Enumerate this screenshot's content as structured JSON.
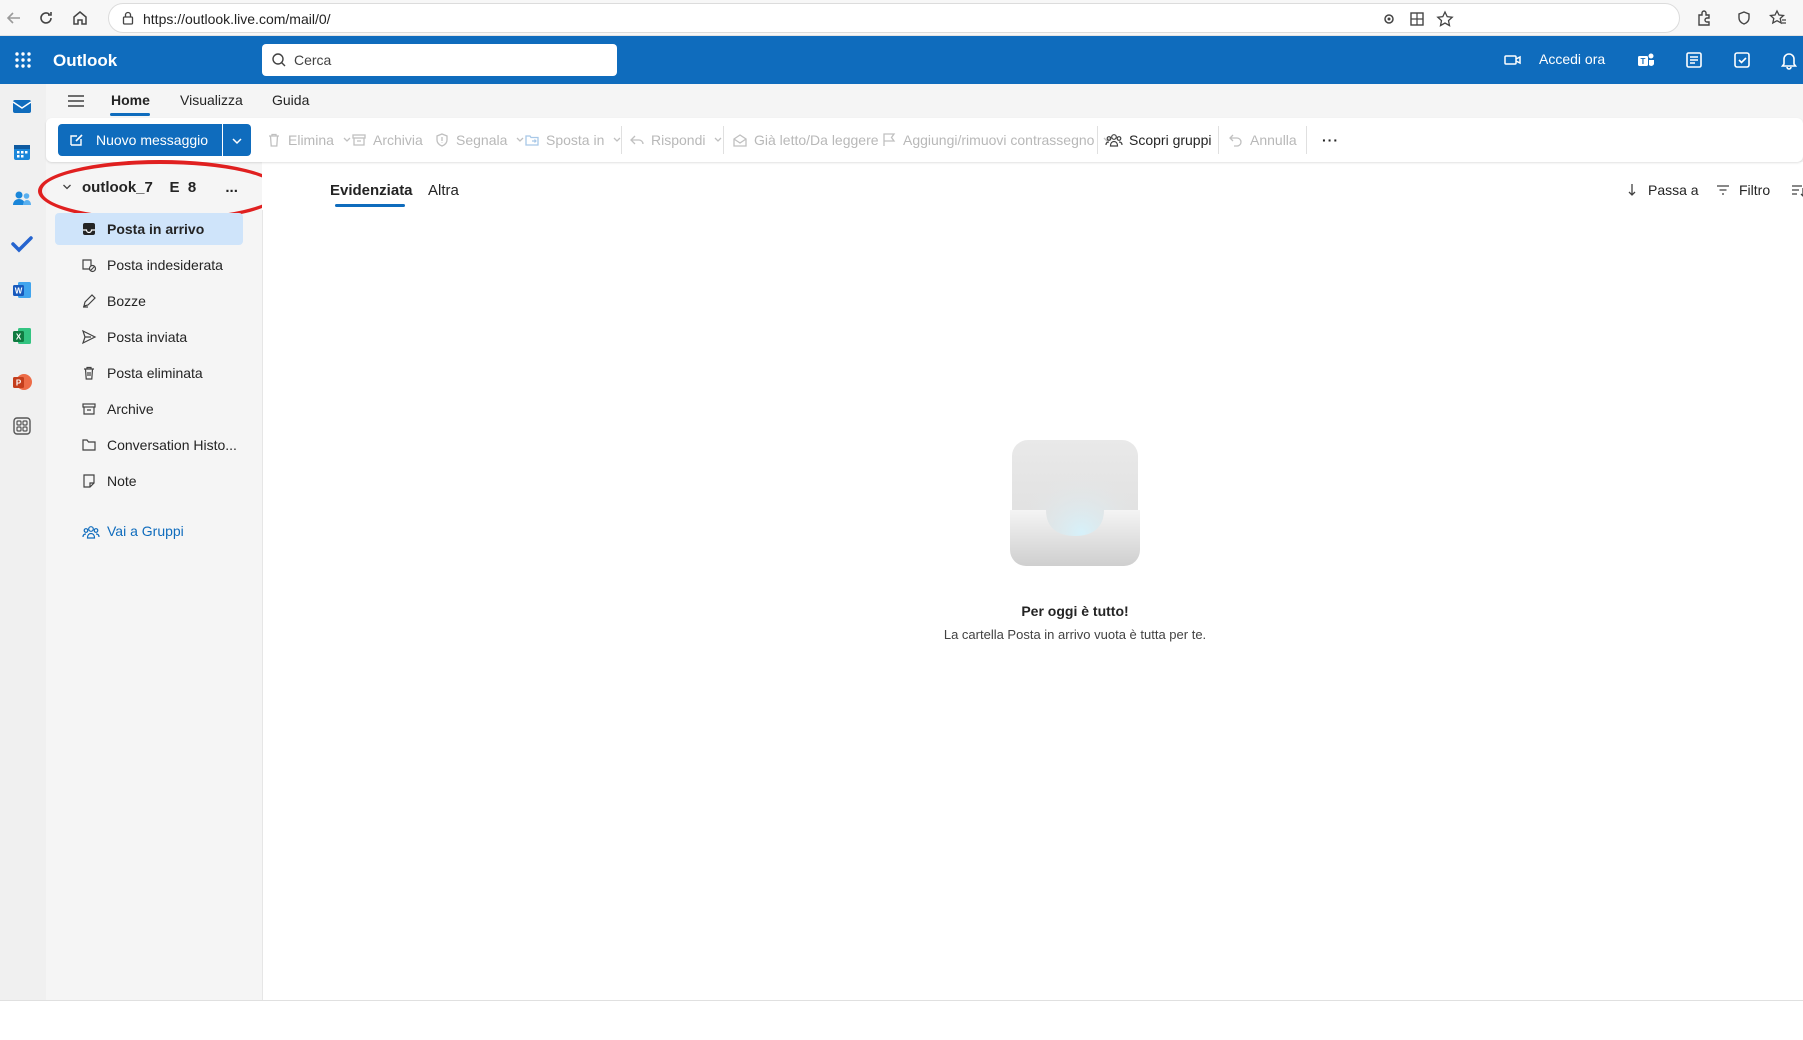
{
  "browser": {
    "url": "https://outlook.live.com/mail/0/"
  },
  "header": {
    "app_title": "Outlook",
    "search_placeholder": "Cerca",
    "meet_now_label": "Accedi ora"
  },
  "ribbon_tabs": [
    "Home",
    "Visualizza",
    "Guida"
  ],
  "ribbon": {
    "new_message": "Nuovo messaggio",
    "commands": {
      "delete": "Elimina",
      "archive": "Archivia",
      "report": "Segnala",
      "move_to": "Sposta in",
      "reply": "Rispondi",
      "read_unread": "Già letto/Da leggere",
      "flag": "Aggiungi/rimuovi contrassegno",
      "discover_groups": "Scopri gruppi",
      "undo": "Annulla",
      "more": "···"
    }
  },
  "account": {
    "name": "outlook_7    E  8       ..."
  },
  "folders": [
    {
      "label": "Posta in arrivo",
      "icon": "inbox-icon",
      "selected": true
    },
    {
      "label": "Posta indesiderata",
      "icon": "junk-icon",
      "selected": false
    },
    {
      "label": "Bozze",
      "icon": "drafts-icon",
      "selected": false
    },
    {
      "label": "Posta inviata",
      "icon": "sent-icon",
      "selected": false
    },
    {
      "label": "Posta eliminata",
      "icon": "trash-icon",
      "selected": false
    },
    {
      "label": "Archive",
      "icon": "archive-icon",
      "selected": false
    },
    {
      "label": "Conversation Histo...",
      "icon": "folder-icon",
      "selected": false
    },
    {
      "label": "Note",
      "icon": "note-icon",
      "selected": false
    }
  ],
  "groups_link": "Vai a Gruppi",
  "message_list": {
    "pivot_focused": "Evidenziata",
    "pivot_other": "Altra",
    "jump_to": "Passa a",
    "filter": "Filtro"
  },
  "empty_state": {
    "title": "Per oggi è tutto!",
    "subtitle": "La cartella Posta in arrivo vuota è tutta per te."
  },
  "colors": {
    "brand": "#0f6cbd",
    "selected_folder": "#cfe4fa",
    "annotation": "#e02020"
  }
}
